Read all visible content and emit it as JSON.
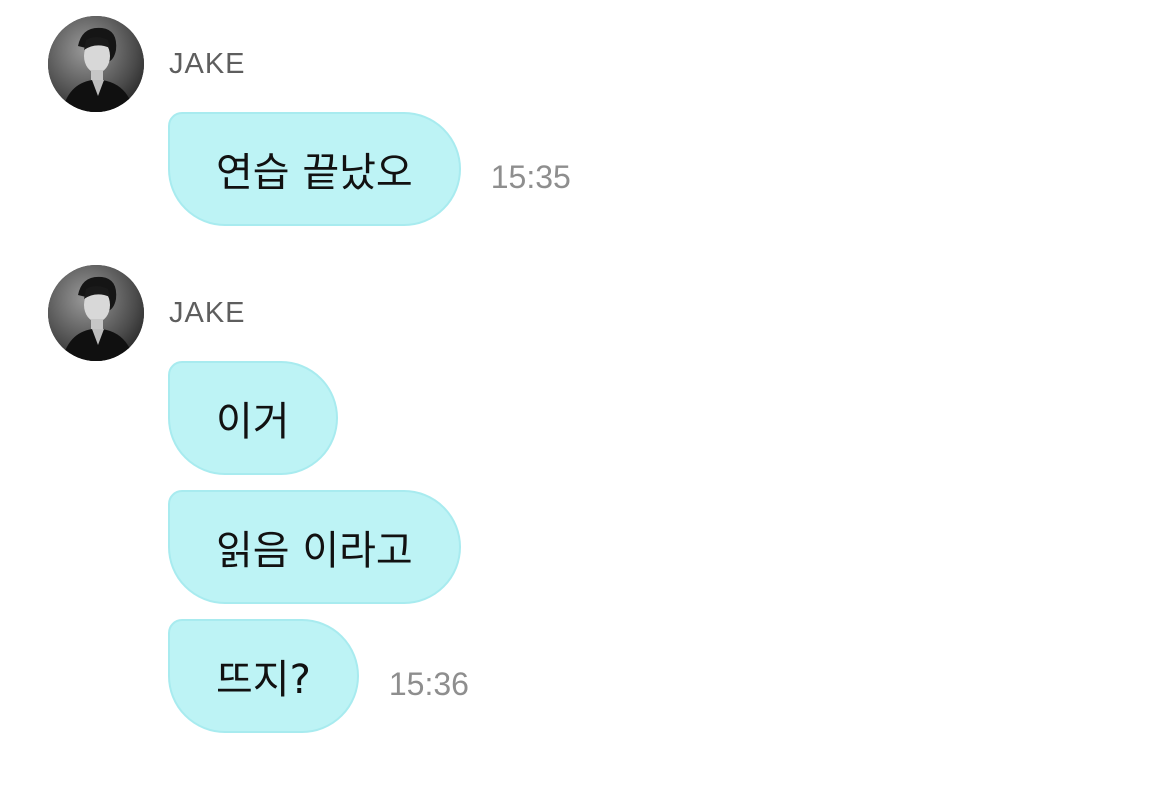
{
  "groups": [
    {
      "sender": "JAKE",
      "messages": [
        {
          "text": "연습 끝났오",
          "time": "15:35"
        }
      ]
    },
    {
      "sender": "JAKE",
      "messages": [
        {
          "text": "이거",
          "time": ""
        },
        {
          "text": "읽음 이라고",
          "time": ""
        },
        {
          "text": "뜨지?",
          "time": "15:36"
        }
      ]
    }
  ],
  "colors": {
    "bubble": "#bdf3f5",
    "bubble_border": "#a8ebef",
    "sender_text": "#5e5e5e",
    "time_text": "#8e8e8e",
    "background": "#ffffff"
  },
  "icons": {
    "avatar": "profile-photo-avatar"
  }
}
